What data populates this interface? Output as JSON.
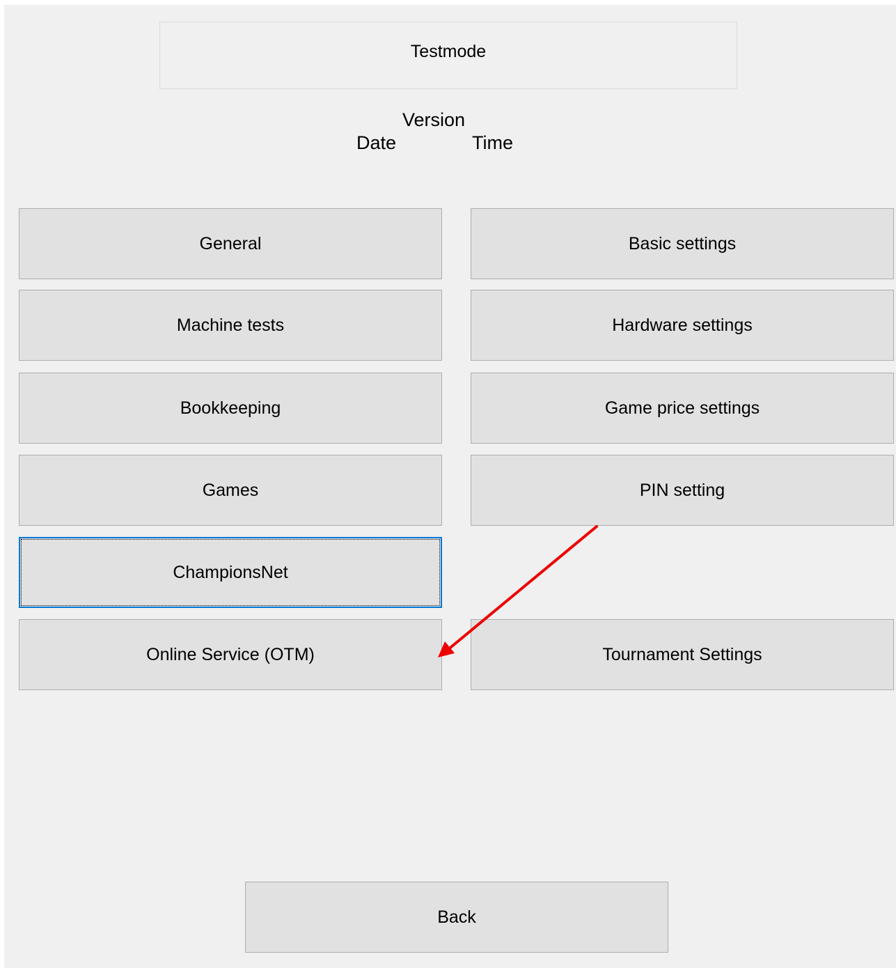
{
  "header": {
    "title": "Testmode",
    "version_label": "Version",
    "date_label": "Date",
    "time_label": "Time"
  },
  "menu": {
    "general": "General",
    "basic_settings": "Basic settings",
    "machine_tests": "Machine tests",
    "hardware_settings": "Hardware settings",
    "bookkeeping": "Bookkeeping",
    "game_price_settings": "Game price settings",
    "games": "Games",
    "pin_setting": "PIN setting",
    "championsnet": "ChampionsNet",
    "online_service": "Online Service (OTM)",
    "tournament_settings": "Tournament Settings"
  },
  "footer": {
    "back": "Back"
  },
  "focused_item": "ChampionsNet",
  "colors": {
    "background": "#f0f0f0",
    "button_face": "#e1e1e1",
    "button_border": "#adadad",
    "focus_border": "#0078d7",
    "annotation_arrow": "#ee0000"
  }
}
